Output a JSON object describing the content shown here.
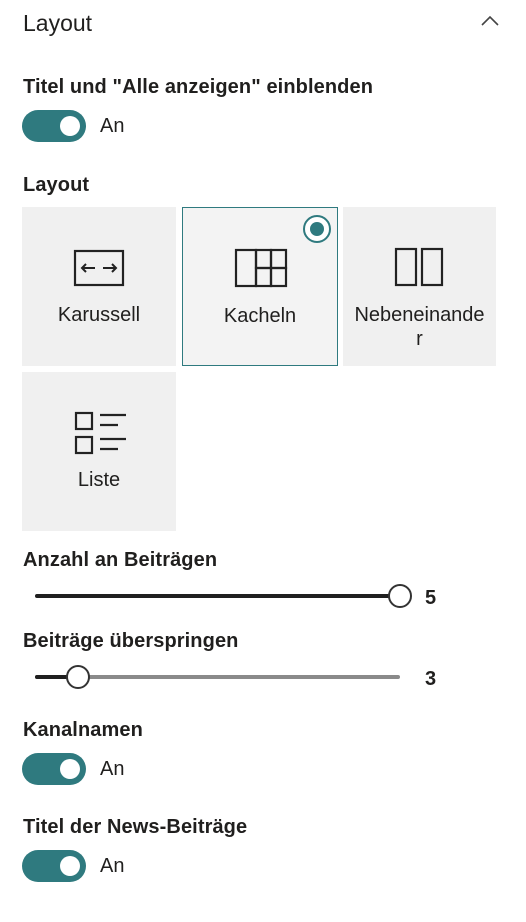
{
  "header": {
    "title": "Layout",
    "collapse_icon": "chevron-up-icon"
  },
  "show_title_toggle": {
    "label": "Titel und \"Alle anzeigen\" einblenden",
    "state": "An",
    "on": true
  },
  "layout": {
    "label": "Layout",
    "options": [
      {
        "label": "Karussell",
        "icon": "carousel-icon",
        "selected": false
      },
      {
        "label": "Kacheln",
        "icon": "tiles-icon",
        "selected": true
      },
      {
        "label_line1": "Nebeneinande",
        "label_line2": "r",
        "icon": "side-by-side-icon",
        "selected": false
      },
      {
        "label": "Liste",
        "icon": "list-icon",
        "selected": false
      }
    ]
  },
  "post_count": {
    "label": "Anzahl an Beiträgen",
    "value": "5"
  },
  "skip_posts": {
    "label": "Beiträge überspringen",
    "value": "3"
  },
  "channel_names": {
    "label": "Kanalnamen",
    "state": "An",
    "on": true
  },
  "news_titles": {
    "label": "Titel der News-Beiträge",
    "state": "An",
    "on": true
  },
  "colors": {
    "accent": "#2f7a7f",
    "card_bg": "#f0f0f0"
  }
}
